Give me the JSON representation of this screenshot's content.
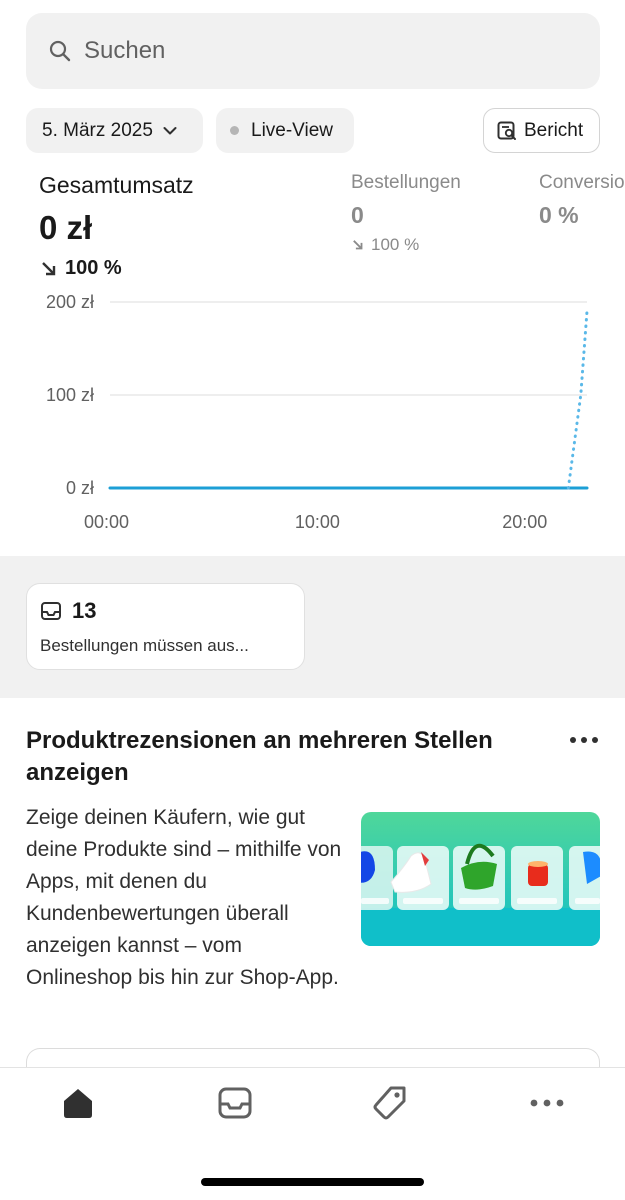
{
  "search": {
    "placeholder": "Suchen",
    "icon": "search-icon"
  },
  "filters": {
    "date_label": "5. März 2025",
    "live_label": "Live-View",
    "report_label": "Bericht"
  },
  "metrics": {
    "total_sales": {
      "title": "Gesamtumsatz",
      "value": "0 zł",
      "change": "100 %"
    },
    "orders": {
      "title": "Bestellungen",
      "value": "0",
      "change": "100 %"
    },
    "conversion": {
      "title": "Conversio",
      "value": "0 %"
    }
  },
  "chart_data": {
    "type": "line",
    "title": "",
    "xlabel": "",
    "ylabel": "",
    "x_ticks": [
      "00:00",
      "10:00",
      "20:00"
    ],
    "y_ticks": [
      "200 zł",
      "100 zł",
      "0 zł"
    ],
    "ylim": [
      0,
      200
    ],
    "xlim_hours": [
      0,
      23
    ],
    "series": [
      {
        "style": "solid",
        "color": "#1c9fd6",
        "x": [
          0,
          23
        ],
        "y": [
          0,
          0
        ]
      },
      {
        "style": "dotted",
        "color": "#5ab8e8",
        "x": [
          22.1,
          22.7,
          23
        ],
        "y": [
          0,
          100,
          190
        ]
      }
    ],
    "grid": true
  },
  "orders_card": {
    "count": "13",
    "label": "Bestellungen müssen aus..."
  },
  "promo": {
    "title": "Produktrezensionen an mehreren Stellen anzeigen",
    "body": "Zeige deinen Käufern, wie gut deine Produkte sind – mithilfe von Apps, mit denen du Kundenbewertungen überall anzeigen kannst – vom Onlineshop bis hin zur Shop-App."
  },
  "tabbar": [
    "home-icon",
    "inbox-icon",
    "tag-icon",
    "more-icon"
  ],
  "colors": {
    "accent": "#1c9fd6",
    "background_gray": "#f1f1f1"
  }
}
